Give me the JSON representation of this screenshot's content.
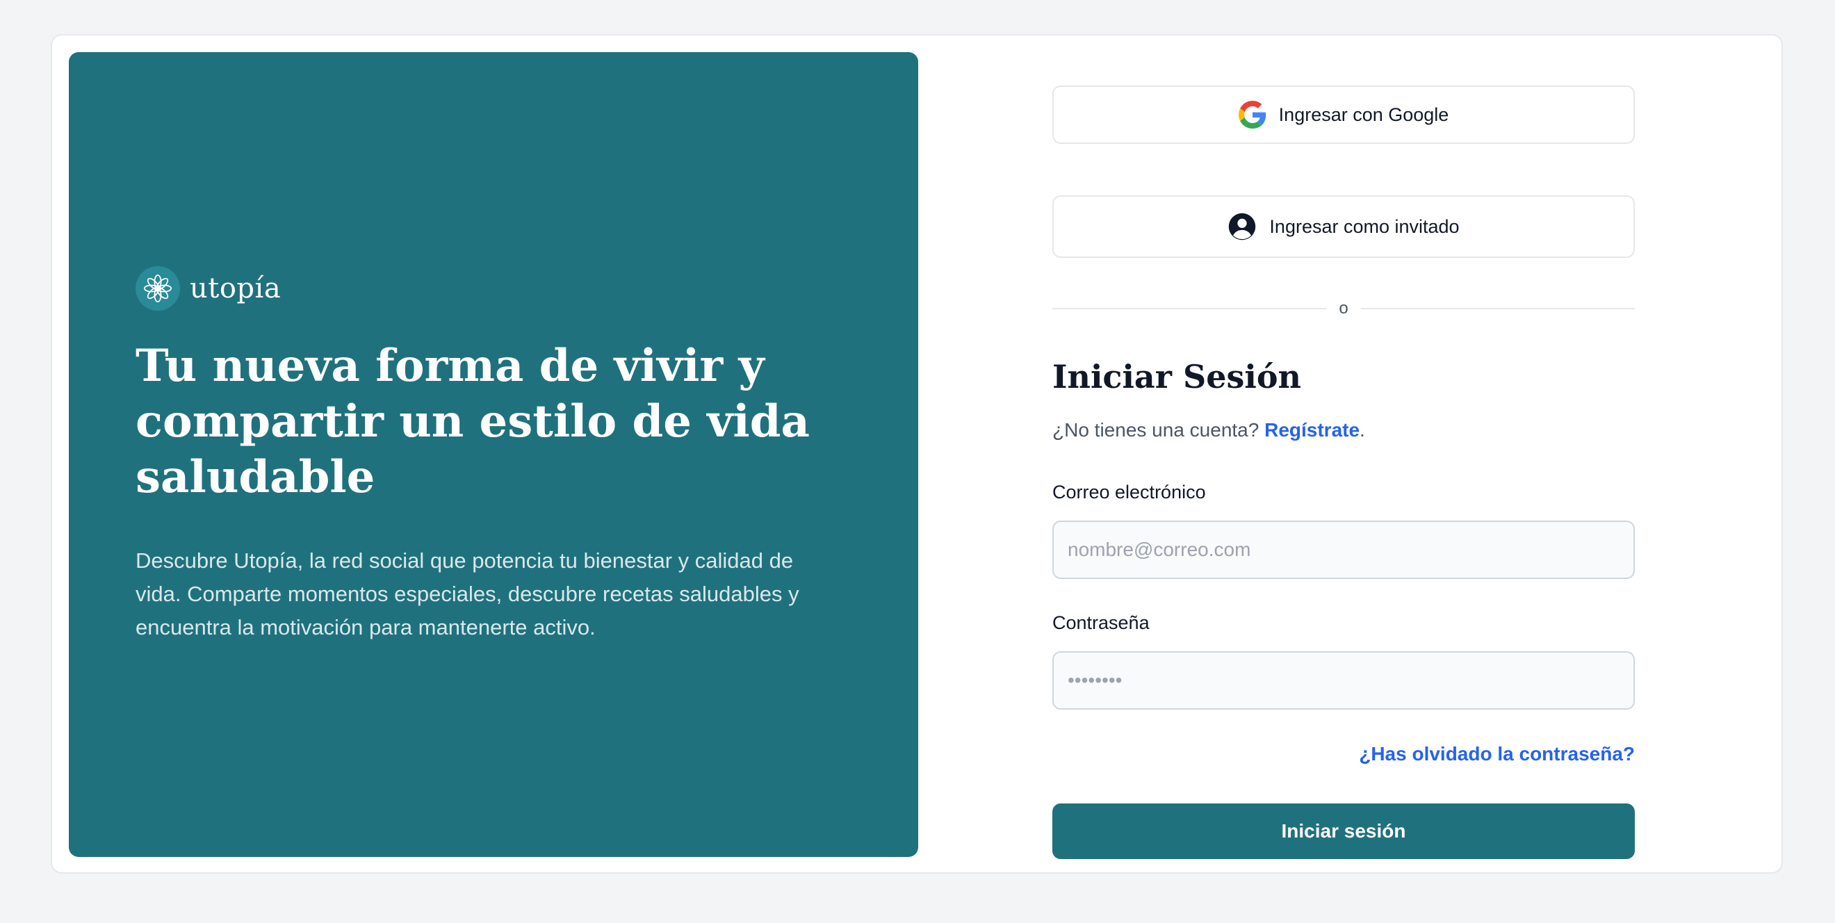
{
  "brand": {
    "name": "utopía",
    "logo_icon": "lotus-flower-icon",
    "accent_color": "#20717e"
  },
  "hero": {
    "title": "Tu nueva forma de vivir y compartir un estilo de vida saludable",
    "description": "Descubre Utopía, la red social que potencia tu bienestar y calidad de vida. Comparte momentos especiales, descubre recetas saludables y encuentra la motivación para mantenerte activo."
  },
  "auth": {
    "google_label": "Ingresar con Google",
    "google_icon": "google-icon",
    "guest_label": "Ingresar como invitado",
    "guest_icon": "user-circle-icon",
    "divider_text": "o"
  },
  "form": {
    "title": "Iniciar Sesión",
    "signup_prompt": "¿No tienes una cuenta?",
    "signup_link": "Regístrate",
    "signup_suffix": ".",
    "email_label": "Correo electrónico",
    "email_placeholder": "nombre@correo.com",
    "password_label": "Contraseña",
    "password_placeholder": "••••••••",
    "forgot_link": "¿Has olvidado la contraseña?",
    "submit_label": "Iniciar sesión",
    "link_color": "#2563eb"
  }
}
